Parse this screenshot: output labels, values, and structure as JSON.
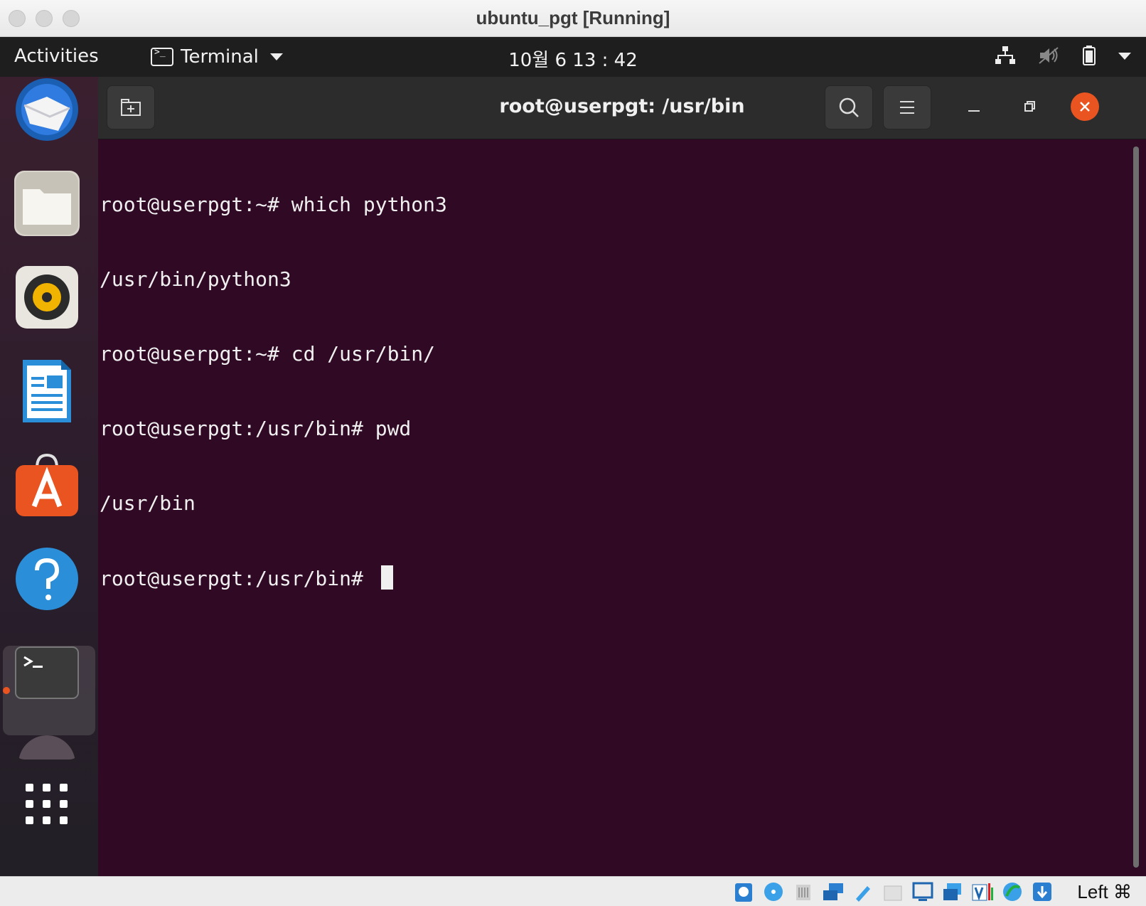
{
  "window": {
    "title": "ubuntu_pgt [Running]"
  },
  "topbar": {
    "activities": "Activities",
    "app_menu_label": "Terminal",
    "clock": "10월 6  13 : 42",
    "tray_icons": [
      "network-icon",
      "volume-muted-icon",
      "battery-icon",
      "system-menu-caret-icon"
    ]
  },
  "dock": {
    "items": [
      "thunderbird-icon",
      "files-icon",
      "rhythmbox-icon",
      "libreoffice-writer-icon",
      "ubuntu-software-icon",
      "help-icon",
      "terminal-icon",
      "trash-or-drive-icon",
      "show-applications-icon"
    ],
    "active": "terminal-icon",
    "accent": "#e95420"
  },
  "terminal": {
    "title": "root@userpgt: /usr/bin",
    "background": "#300a24",
    "lines": [
      "root@userpgt:~# which python3",
      "/usr/bin/python3",
      "root@userpgt:~# cd /usr/bin/",
      "root@userpgt:/usr/bin# pwd",
      "/usr/bin",
      "root@userpgt:/usr/bin# "
    ]
  },
  "statusbar": {
    "host_key": "Left ⌘",
    "icons": [
      "hard-disk-icon",
      "optical-drive-icon",
      "audio-icon",
      "network-adapter-icon",
      "usb-icon",
      "shared-folders-icon",
      "display-icon",
      "capture-icon",
      "vt-x-icon",
      "guest-additions-icon",
      "download-icon"
    ]
  }
}
